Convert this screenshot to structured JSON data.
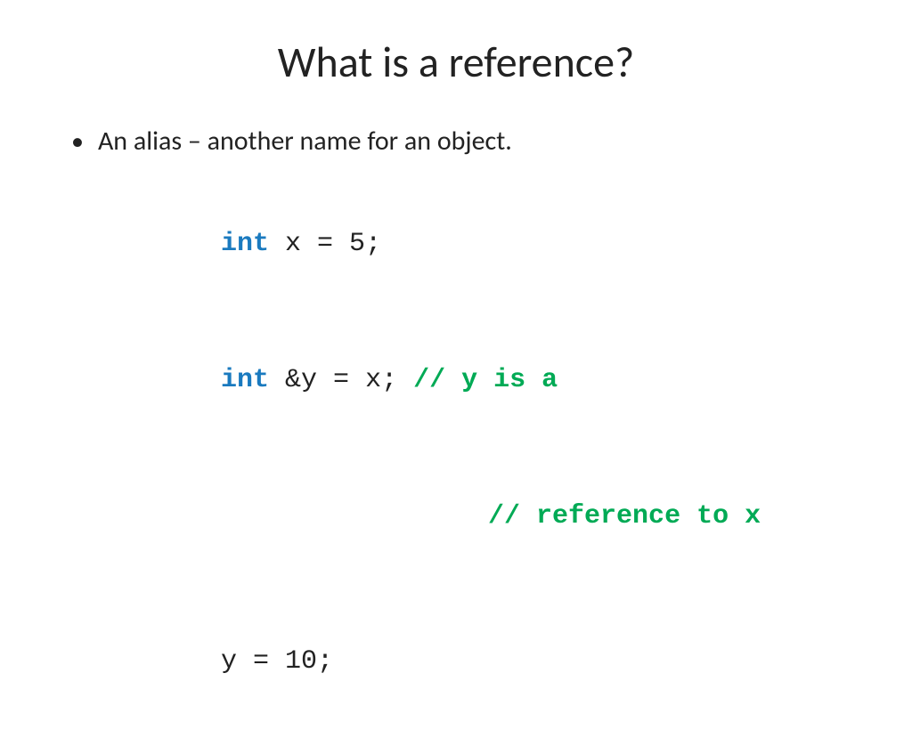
{
  "slide": {
    "title": "What is a reference?",
    "bullet": {
      "text": "An alias – another name for an object."
    },
    "code": {
      "line1_kw": "int",
      "line1_rest": " x = 5;",
      "line2_kw": "int",
      "line2_rest": " &y = x;",
      "line2_comment": "// y is a",
      "line3_comment": "// reference to x",
      "line4": "y = 10;"
    }
  }
}
